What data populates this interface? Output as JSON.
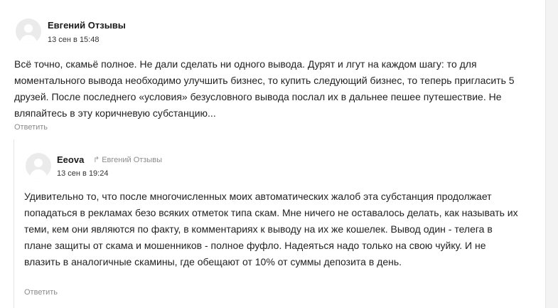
{
  "comment1": {
    "author": "Евгений Отзывы",
    "date": "13 сен в 15:48",
    "text": "Всё точно, скамьё полное. Не дали сделать ни одного вывода. Дурят и лгут на каждом шагу: то для моментального вывода необходимо улучшить бизнес, то купить следующий бизнес, то теперь пригласить 5 друзей. После последнего «условия» безусловного вывода послал их в дальнее пешее путешествие. Не вляпайтесь в эту коричневую субстанцию...",
    "reply_label": "Ответить"
  },
  "comment2": {
    "author": "Eeova",
    "reply_to": "Евгений Отзывы",
    "date": "13 сен в 19:24",
    "text": "Удивительно то, что после многочисленных моих автоматических жалоб эта субстанция продолжает попадаться в рекламах безо всяких отметок типа скам. Мне ничего не оставалось делать, как называть их теми, кем они являются по факту, в комментариях к выводу на их же кошелек. Вывод один - телега в плане защиты от скама и мошенников - полное фуфло. Надеяться надо только на свою чуйку. И не влазить в аналогичные скамины, где обещают от 10% от суммы депозита в день.",
    "reply_label": "Ответить"
  },
  "icons": {
    "avatar": "user-placeholder-avatar",
    "reply_arrow": "reply-arrow-icon"
  }
}
